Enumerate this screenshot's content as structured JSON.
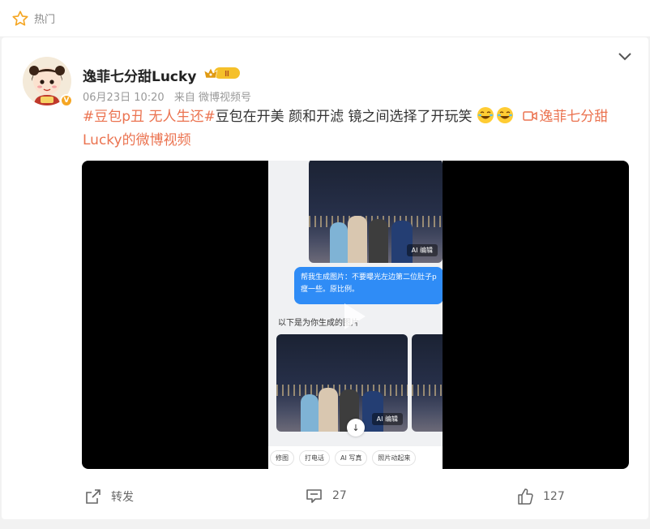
{
  "top": {
    "label": "热门",
    "icon": "star-outline-icon",
    "icon_color": "#f5a623"
  },
  "post": {
    "username": "逸菲七分甜Lucky",
    "rank_badge": "II",
    "verified_badge": "V",
    "time": "06月23日 10:20",
    "source": "来自 微博视频号",
    "text": {
      "hashtag": "#豆包p丑 无人生还#",
      "body": "豆包在开美 颜和开滤 镜之间选择了开玩笑",
      "video_link": "逸菲七分甜Lucky的微博视频"
    },
    "video": {
      "bubble": "帮我生成图片：不要曝光左边第二位肚子p瘦一些。原比例。",
      "gen_text": "以下是为你生成的图片",
      "ai_tag": "AI 编辑",
      "tools": [
        "修图",
        "打电话",
        "AI 写真",
        "照片动起来"
      ]
    },
    "actions": {
      "repost": "转发",
      "comments": "27",
      "likes": "127"
    }
  },
  "colors": {
    "link": "#eb7350",
    "accent": "#f5a623",
    "bubble": "#2f8cf6"
  }
}
